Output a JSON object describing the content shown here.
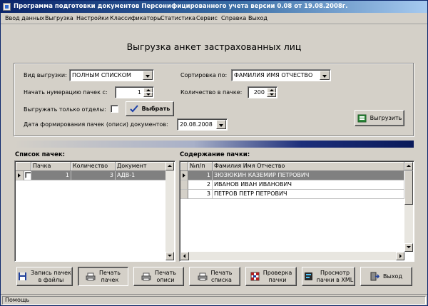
{
  "window": {
    "title": "Программа подготовки документов Персонифицированного учета версии 0.08 от 19.08.2008г."
  },
  "menu": [
    {
      "label": "Ввод данных"
    },
    {
      "label": "Выгрузка"
    },
    {
      "label": "Настройки"
    },
    {
      "label": "Классификаторы"
    },
    {
      "label": "Статистика"
    },
    {
      "label": "Сервис"
    },
    {
      "label": "Справка"
    },
    {
      "label": "Выход"
    }
  ],
  "form": {
    "heading": "Выгрузка анкет застрахованных лиц",
    "export_type": {
      "label": "Вид выгрузки:",
      "value": "ПОЛНЫМ СПИСКОМ"
    },
    "sort": {
      "label": "Сортировка по:",
      "value": "ФАМИЛИЯ ИМЯ ОТЧЕСТВО"
    },
    "start_number": {
      "label": "Начать нумерацию пачек с:",
      "value": "1"
    },
    "pack_size": {
      "label": "Количество в пачке:",
      "value": "200"
    },
    "only_departments": {
      "label": "Выгружать только отделы:",
      "checked": false
    },
    "choose_button": "Выбрать",
    "date": {
      "label": "Дата формирования пачек (описи) документов:",
      "value": "20.08.2008"
    },
    "export_button": "Выгрузить"
  },
  "packs": {
    "title": "Список пачек:",
    "columns": [
      "Пачка",
      "Количество",
      "Документ"
    ],
    "rows": [
      {
        "pack": "1",
        "count": "3",
        "document": "АДВ-1",
        "checked": false
      }
    ]
  },
  "contents": {
    "title": "Содержание пачки:",
    "columns": [
      "№п/п",
      "Фамилия Имя Отчество"
    ],
    "rows": [
      {
        "num": "1",
        "name": "ЗЮЗЮКИН КАЗЕМИР ПЕТРОВИЧ"
      },
      {
        "num": "2",
        "name": "ИВАНОВ ИВАН ИВАНОВИЧ"
      },
      {
        "num": "3",
        "name": "ПЕТРОВ ПЕТР ПЕТРОВИЧ"
      }
    ]
  },
  "toolbar": [
    {
      "line1": "Запись пачек",
      "line2": "в файлы",
      "icon": "floppy-disk-icon"
    },
    {
      "line1": "Печать",
      "line2": "пачек",
      "icon": "printer-icon"
    },
    {
      "line1": "Печать",
      "line2": "описи",
      "icon": "printer-icon"
    },
    {
      "line1": "Печать",
      "line2": "списка",
      "icon": "printer-icon"
    },
    {
      "line1": "Проверка",
      "line2": "пачки",
      "icon": "checker-icon"
    },
    {
      "line1": "Просмотр",
      "line2": "пачки в XML",
      "icon": "xml-view-icon"
    },
    {
      "line1": "Выход",
      "line2": "",
      "icon": "exit-door-icon"
    }
  ],
  "statusbar": {
    "text": "Помощь"
  },
  "colors": {
    "titlebar": "#0a246a",
    "selected_row": "#808080",
    "face": "#d4d0c8"
  }
}
